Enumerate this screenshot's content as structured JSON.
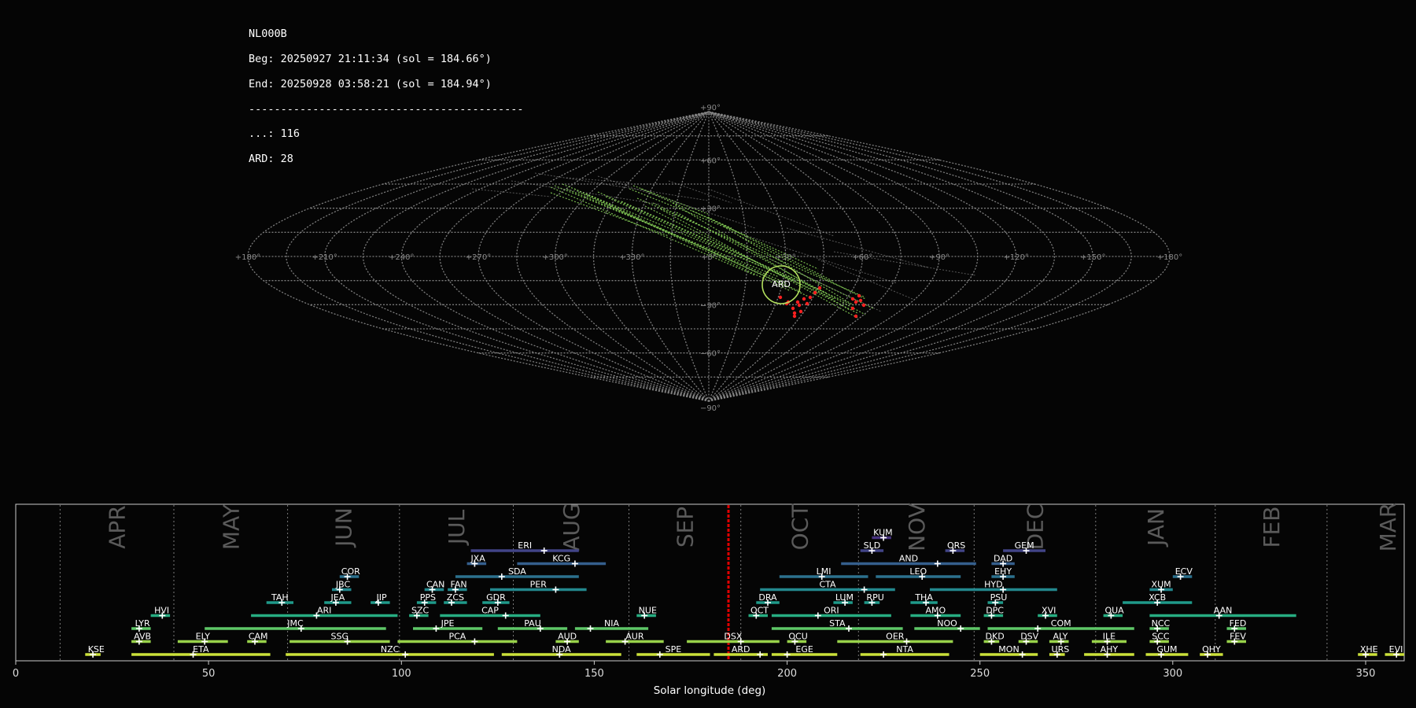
{
  "info": {
    "station": "NL000B",
    "beg": "Beg: 20250927 21:11:34 (sol = 184.66°)",
    "end": "End: 20250928 03:58:21 (sol = 184.94°)",
    "separator": "-------------------------------------------",
    "count_sporadic": "...: 116",
    "count_ard": "ARD: 28"
  },
  "sky": {
    "lon_labels": [
      "+180°",
      "+150°",
      "+120°",
      "+90°",
      "+60°",
      "+30°",
      "+0°",
      "+330°",
      "+300°",
      "+270°",
      "+240°",
      "+210°",
      "+180°"
    ],
    "lat_labels": [
      "+90°",
      "+60°",
      "+30°",
      "−30°",
      "−60°",
      "−90°"
    ],
    "radiant_label": "ARD",
    "colors": {
      "grid": "#8a8a8a",
      "tracks": "#8ad65a",
      "heads": "#ff2020",
      "radiant": "#b2e05e",
      "sporadic": "#9a9a9a"
    }
  },
  "chart_data": {
    "type": "range-bar",
    "xlabel": "Solar longitude (deg)",
    "xlim": [
      0,
      360
    ],
    "xticks": [
      0,
      50,
      100,
      150,
      200,
      250,
      300,
      350
    ],
    "current_sol": 184.8,
    "months": [
      {
        "name": "APR",
        "start": 11.5,
        "end": 41
      },
      {
        "name": "MAY",
        "start": 41,
        "end": 70.5
      },
      {
        "name": "JUN",
        "start": 70.5,
        "end": 99.5
      },
      {
        "name": "JUL",
        "start": 99.5,
        "end": 129
      },
      {
        "name": "AUG",
        "start": 129,
        "end": 159
      },
      {
        "name": "SEP",
        "start": 159,
        "end": 188
      },
      {
        "name": "OCT",
        "start": 188,
        "end": 218.5
      },
      {
        "name": "NOV",
        "start": 218.5,
        "end": 248.5
      },
      {
        "name": "DEC",
        "start": 248.5,
        "end": 280
      },
      {
        "name": "JAN",
        "start": 280,
        "end": 311
      },
      {
        "name": "FEB",
        "start": 311,
        "end": 340
      },
      {
        "name": "MAR",
        "start": 340,
        "end": 371.5
      }
    ],
    "showers": [
      {
        "code": "KUM",
        "start": 222,
        "end": 227,
        "peak": 225,
        "row": 9
      },
      {
        "code": "ERI",
        "start": 118,
        "end": 146,
        "peak": 137,
        "row": 8
      },
      {
        "code": "SLD",
        "start": 219,
        "end": 225,
        "peak": 222,
        "row": 8
      },
      {
        "code": "ORS",
        "start": 241,
        "end": 246,
        "peak": 243,
        "row": 8
      },
      {
        "code": "GEM",
        "start": 256,
        "end": 267,
        "peak": 262,
        "row": 8
      },
      {
        "code": "JXA",
        "start": 117,
        "end": 122,
        "peak": 119,
        "row": 7
      },
      {
        "code": "KCG",
        "start": 130,
        "end": 153,
        "peak": 145,
        "row": 7
      },
      {
        "code": "AND",
        "start": 214,
        "end": 249,
        "peak": 239,
        "row": 7
      },
      {
        "code": "DAD",
        "start": 253,
        "end": 259,
        "peak": 256,
        "row": 7
      },
      {
        "code": "COR",
        "start": 84,
        "end": 89,
        "peak": 86,
        "row": 6
      },
      {
        "code": "SDA",
        "start": 114,
        "end": 146,
        "peak": 126,
        "row": 6
      },
      {
        "code": "LMI",
        "start": 198,
        "end": 221,
        "peak": 209,
        "row": 6
      },
      {
        "code": "LEO",
        "start": 223,
        "end": 245,
        "peak": 235,
        "row": 6
      },
      {
        "code": "EHY",
        "start": 253,
        "end": 259,
        "peak": 256,
        "row": 6
      },
      {
        "code": "ECV",
        "start": 300,
        "end": 305,
        "peak": 302,
        "row": 6
      },
      {
        "code": "JBC",
        "start": 82,
        "end": 87,
        "peak": 84,
        "row": 5
      },
      {
        "code": "CAN",
        "start": 106,
        "end": 111,
        "peak": 108,
        "row": 5
      },
      {
        "code": "FAN",
        "start": 112,
        "end": 117,
        "peak": 114,
        "row": 5
      },
      {
        "code": "PER",
        "start": 123,
        "end": 148,
        "peak": 140,
        "row": 5
      },
      {
        "code": "CTA",
        "start": 193,
        "end": 228,
        "peak": 220,
        "row": 5
      },
      {
        "code": "HYD",
        "start": 237,
        "end": 270,
        "peak": 256,
        "row": 5
      },
      {
        "code": "XUM",
        "start": 294,
        "end": 300,
        "peak": 297,
        "row": 5
      },
      {
        "code": "TAH",
        "start": 65,
        "end": 72,
        "peak": 69,
        "row": 4
      },
      {
        "code": "JEA",
        "start": 80,
        "end": 87,
        "peak": 83,
        "row": 4
      },
      {
        "code": "JIP",
        "start": 92,
        "end": 97,
        "peak": 94,
        "row": 4
      },
      {
        "code": "PPS",
        "start": 104,
        "end": 109,
        "peak": 106,
        "row": 4
      },
      {
        "code": "ZCS",
        "start": 111,
        "end": 117,
        "peak": 113,
        "row": 4
      },
      {
        "code": "GDR",
        "start": 121,
        "end": 128,
        "peak": 125,
        "row": 4
      },
      {
        "code": "DRA",
        "start": 192,
        "end": 198,
        "peak": 195,
        "row": 4
      },
      {
        "code": "LUM",
        "start": 212,
        "end": 217,
        "peak": 215,
        "row": 4
      },
      {
        "code": "RPU",
        "start": 220,
        "end": 224,
        "peak": 222,
        "row": 4
      },
      {
        "code": "THA",
        "start": 232,
        "end": 239,
        "peak": 236,
        "row": 4
      },
      {
        "code": "PSU",
        "start": 252,
        "end": 256,
        "peak": 254,
        "row": 4
      },
      {
        "code": "XCB",
        "start": 287,
        "end": 305,
        "peak": 296,
        "row": 4
      },
      {
        "code": "HVI",
        "start": 35,
        "end": 40,
        "peak": 38,
        "row": 3
      },
      {
        "code": "ARI",
        "start": 61,
        "end": 99,
        "peak": 78,
        "row": 3
      },
      {
        "code": "SZC",
        "start": 102,
        "end": 107,
        "peak": 104,
        "row": 3
      },
      {
        "code": "CAP",
        "start": 110,
        "end": 136,
        "peak": 127,
        "row": 3
      },
      {
        "code": "NUE",
        "start": 161,
        "end": 166,
        "peak": 163,
        "row": 3
      },
      {
        "code": "OCT",
        "start": 190,
        "end": 195,
        "peak": 192,
        "row": 3
      },
      {
        "code": "ORI",
        "start": 196,
        "end": 227,
        "peak": 208,
        "row": 3
      },
      {
        "code": "AMO",
        "start": 232,
        "end": 245,
        "peak": 239,
        "row": 3
      },
      {
        "code": "DPC",
        "start": 251,
        "end": 256,
        "peak": 253,
        "row": 3
      },
      {
        "code": "XVI",
        "start": 265,
        "end": 270,
        "peak": 267,
        "row": 3
      },
      {
        "code": "QUA",
        "start": 282,
        "end": 287,
        "peak": 284,
        "row": 3
      },
      {
        "code": "AAN",
        "start": 294,
        "end": 332,
        "peak": 312,
        "row": 3
      },
      {
        "code": "LYR",
        "start": 30,
        "end": 35,
        "peak": 32,
        "row": 2
      },
      {
        "code": "JMC",
        "start": 49,
        "end": 96,
        "peak": 74,
        "row": 2
      },
      {
        "code": "JPE",
        "start": 103,
        "end": 121,
        "peak": 109,
        "row": 2
      },
      {
        "code": "PAU",
        "start": 125,
        "end": 143,
        "peak": 136,
        "row": 2
      },
      {
        "code": "NIA",
        "start": 145,
        "end": 164,
        "peak": 149,
        "row": 2
      },
      {
        "code": "STA",
        "start": 196,
        "end": 230,
        "peak": 216,
        "row": 2
      },
      {
        "code": "NOO",
        "start": 233,
        "end": 250,
        "peak": 245,
        "row": 2
      },
      {
        "code": "COM",
        "start": 252,
        "end": 290,
        "peak": 265,
        "row": 2
      },
      {
        "code": "NCC",
        "start": 294,
        "end": 299,
        "peak": 296,
        "row": 2
      },
      {
        "code": "FED",
        "start": 314,
        "end": 319,
        "peak": 316,
        "row": 2
      },
      {
        "code": "AVB",
        "start": 30,
        "end": 35,
        "peak": 32,
        "row": 1
      },
      {
        "code": "ELY",
        "start": 42,
        "end": 55,
        "peak": 49,
        "row": 1
      },
      {
        "code": "CAM",
        "start": 60,
        "end": 65,
        "peak": 62,
        "row": 1
      },
      {
        "code": "SSG",
        "start": 71,
        "end": 97,
        "peak": 86,
        "row": 1
      },
      {
        "code": "PCA",
        "start": 99,
        "end": 130,
        "peak": 119,
        "row": 1
      },
      {
        "code": "AUD",
        "start": 140,
        "end": 146,
        "peak": 143,
        "row": 1
      },
      {
        "code": "AUR",
        "start": 153,
        "end": 168,
        "peak": 158,
        "row": 1
      },
      {
        "code": "DSX",
        "start": 174,
        "end": 198,
        "peak": 188,
        "row": 1
      },
      {
        "code": "OCU",
        "start": 200,
        "end": 205,
        "peak": 202,
        "row": 1
      },
      {
        "code": "OER",
        "start": 213,
        "end": 243,
        "peak": 231,
        "row": 1
      },
      {
        "code": "DKD",
        "start": 251,
        "end": 255,
        "peak": 253,
        "row": 1
      },
      {
        "code": "DSV",
        "start": 260,
        "end": 265,
        "peak": 262,
        "row": 1
      },
      {
        "code": "ALY",
        "start": 268,
        "end": 273,
        "peak": 271,
        "row": 1
      },
      {
        "code": "ILE",
        "start": 279,
        "end": 288,
        "peak": 283,
        "row": 1
      },
      {
        "code": "SCC",
        "start": 294,
        "end": 299,
        "peak": 296,
        "row": 1
      },
      {
        "code": "FEV",
        "start": 314,
        "end": 319,
        "peak": 316,
        "row": 1
      },
      {
        "code": "KSE",
        "start": 18,
        "end": 22,
        "peak": 20,
        "row": 0
      },
      {
        "code": "ETA",
        "start": 30,
        "end": 66,
        "peak": 46,
        "row": 0
      },
      {
        "code": "NZC",
        "start": 70,
        "end": 124,
        "peak": 101,
        "row": 0
      },
      {
        "code": "NDA",
        "start": 126,
        "end": 157,
        "peak": 141,
        "row": 0
      },
      {
        "code": "SPE",
        "start": 161,
        "end": 180,
        "peak": 167,
        "row": 0
      },
      {
        "code": "ARD",
        "start": 181,
        "end": 195,
        "peak": 193,
        "row": 0
      },
      {
        "code": "EGE",
        "start": 196,
        "end": 213,
        "peak": 200,
        "row": 0
      },
      {
        "code": "NTA",
        "start": 219,
        "end": 242,
        "peak": 225,
        "row": 0
      },
      {
        "code": "MON",
        "start": 250,
        "end": 265,
        "peak": 261,
        "row": 0
      },
      {
        "code": "URS",
        "start": 268,
        "end": 272,
        "peak": 270,
        "row": 0
      },
      {
        "code": "AHY",
        "start": 277,
        "end": 290,
        "peak": 283,
        "row": 0
      },
      {
        "code": "GUM",
        "start": 293,
        "end": 304,
        "peak": 297,
        "row": 0
      },
      {
        "code": "OHY",
        "start": 307,
        "end": 313,
        "peak": 309,
        "row": 0
      },
      {
        "code": "XHE",
        "start": 348,
        "end": 353,
        "peak": 350,
        "row": 0
      },
      {
        "code": "EVI",
        "start": 355,
        "end": 360,
        "peak": 358,
        "row": 0
      }
    ]
  }
}
